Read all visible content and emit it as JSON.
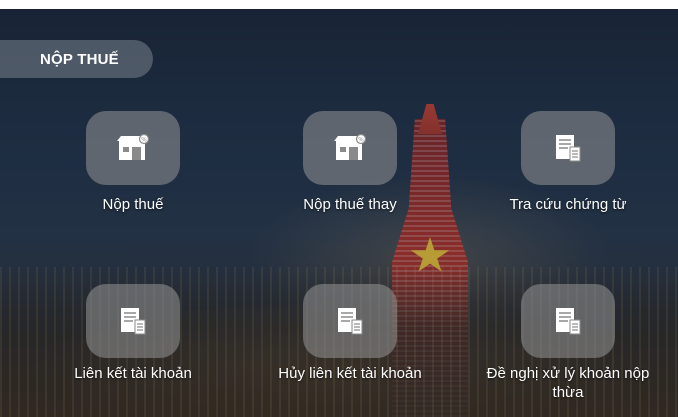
{
  "section": {
    "title": "NỘP THUẾ"
  },
  "tiles": [
    {
      "label": "Nộp thuế",
      "icon": "storefront-icon"
    },
    {
      "label": "Nộp thuế thay",
      "icon": "storefront-icon"
    },
    {
      "label": "Tra cứu chứng từ",
      "icon": "documents-icon"
    },
    {
      "label": "Liên kết tài khoản",
      "icon": "documents-icon"
    },
    {
      "label": "Hủy liên kết tài khoản",
      "icon": "documents-icon"
    },
    {
      "label": "Đề nghị xử lý khoản nộp thừa",
      "icon": "documents-icon"
    }
  ],
  "colors": {
    "text": "#ffffff",
    "tile_bg": "#969696",
    "pill_bg": "#78828c"
  }
}
